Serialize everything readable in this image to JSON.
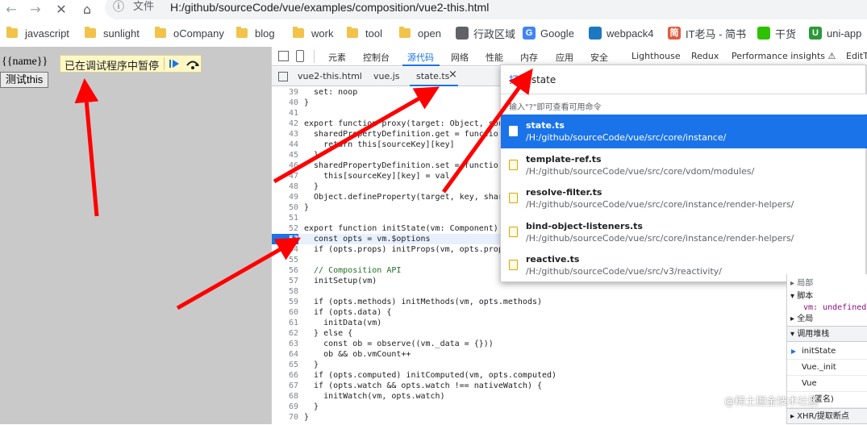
{
  "browser": {
    "nav": {
      "back": "←",
      "forward": "→",
      "stop": "✕",
      "home": "⌂"
    },
    "omnibox": {
      "info_icon": "ⓘ",
      "scheme_label": "文件",
      "url": "H:/github/sourceCode/vue/examples/composition/vue2-this.html"
    },
    "bookmarks": [
      {
        "label": "javascript",
        "icon": "folder"
      },
      {
        "label": "sunlight",
        "icon": "folder"
      },
      {
        "label": "oCompany",
        "icon": "folder"
      },
      {
        "label": "blog",
        "icon": "folder"
      },
      {
        "label": "work",
        "icon": "folder"
      },
      {
        "label": "tool",
        "icon": "folder"
      },
      {
        "label": "open",
        "icon": "folder"
      },
      {
        "label": "行政区域",
        "icon": "page"
      },
      {
        "label": "Google",
        "icon": "G"
      },
      {
        "label": "webpack4",
        "icon": "cube"
      },
      {
        "label": "IT老马 - 简书",
        "icon": "简"
      },
      {
        "label": "干货",
        "icon": "wechat"
      },
      {
        "label": "uni-app",
        "icon": "U"
      }
    ]
  },
  "page": {
    "template_text": "{{name}}",
    "button_label": "测试this",
    "paused_label": "已在调试程序中暂停",
    "resume_icon": "resume-icon",
    "step_over_icon": "step-over-icon"
  },
  "devtools": {
    "tabs": [
      "元素",
      "控制台",
      "源代码",
      "网络",
      "性能",
      "内存",
      "应用",
      "安全",
      "Lighthouse",
      "Redux",
      "Performance insights ⚠",
      "EditT"
    ],
    "active_tab": "源代码",
    "file_tabs": [
      "vue2-this.html",
      "vue.js",
      "state.ts"
    ],
    "active_file_close": "×",
    "code_lines": [
      {
        "n": "39",
        "t": "  set: noop"
      },
      {
        "n": "40",
        "t": "}"
      },
      {
        "n": "41",
        "t": ""
      },
      {
        "n": "42",
        "t": "export function proxy(target: Object, sou"
      },
      {
        "n": "43",
        "t": "  sharedPropertyDefinition.get = functio"
      },
      {
        "n": "44",
        "t": "    return this[sourceKey][key]"
      },
      {
        "n": "45",
        "t": "  }"
      },
      {
        "n": "46",
        "t": "  sharedPropertyDefinition.set = functio"
      },
      {
        "n": "47",
        "t": "    this[sourceKey][key] = val"
      },
      {
        "n": "48",
        "t": "  }"
      },
      {
        "n": "49",
        "t": "  Object.defineProperty(target, key, shar"
      },
      {
        "n": "50",
        "t": "}"
      },
      {
        "n": "51",
        "t": ""
      },
      {
        "n": "52",
        "t": "export function initState(vm: Component)"
      },
      {
        "n": "53",
        "t": "  const opts = vm.$options"
      },
      {
        "n": "54",
        "t": "  if (opts.props) initProps(vm, opts.prop"
      },
      {
        "n": "55",
        "t": ""
      },
      {
        "n": "56",
        "t": "  // Composition API"
      },
      {
        "n": "57",
        "t": "  initSetup(vm)"
      },
      {
        "n": "58",
        "t": ""
      },
      {
        "n": "59",
        "t": "  if (opts.methods) initMethods(vm, opts.methods)"
      },
      {
        "n": "60",
        "t": "  if (opts.data) {"
      },
      {
        "n": "61",
        "t": "    initData(vm)"
      },
      {
        "n": "62",
        "t": "  } else {"
      },
      {
        "n": "63",
        "t": "    const ob = observe((vm._data = {}))"
      },
      {
        "n": "64",
        "t": "    ob && ob.vmCount++"
      },
      {
        "n": "65",
        "t": "  }"
      },
      {
        "n": "66",
        "t": "  if (opts.computed) initComputed(vm, opts.computed)"
      },
      {
        "n": "67",
        "t": "  if (opts.watch && opts.watch !== nativeWatch) {"
      },
      {
        "n": "68",
        "t": "    initWatch(vm, opts.watch)"
      },
      {
        "n": "69",
        "t": "  }"
      },
      {
        "n": "70",
        "t": "}"
      }
    ],
    "current_line": "53",
    "palette": {
      "prefix": "打开",
      "query": "state",
      "hint": "输入\"?\"即可查看可用命令",
      "results": [
        {
          "name": "state.ts",
          "path": "/H:/github/sourceCode/vue/src/core/instance/",
          "selected": true
        },
        {
          "name": "template-ref.ts",
          "path": "/H:/github/sourceCode/vue/src/core/vdom/modules/",
          "selected": false
        },
        {
          "name": "resolve-filter.ts",
          "path": "/H:/github/sourceCode/vue/src/core/instance/render-helpers/",
          "selected": false
        },
        {
          "name": "bind-object-listeners.ts",
          "path": "/H:/github/sourceCode/vue/src/core/instance/render-helpers/",
          "selected": false
        },
        {
          "name": "reactive.ts",
          "path": "/H:/github/sourceCode/vue/src/v3/reactivity/",
          "selected": false
        }
      ]
    },
    "sidebar": {
      "scope_partial": "▸ 局部",
      "script_label": "▾ 脚本",
      "script_var": "vm: undefined",
      "global_label": "▸ 全局",
      "call_stack_label": "▾ 调用堆栈",
      "frames": [
        "initState",
        "Vue._init",
        "Vue",
        "(匿名)"
      ],
      "xhr_label": "▸ XHR/提取断点"
    }
  },
  "watermark": "@稀土掘金技术社区"
}
